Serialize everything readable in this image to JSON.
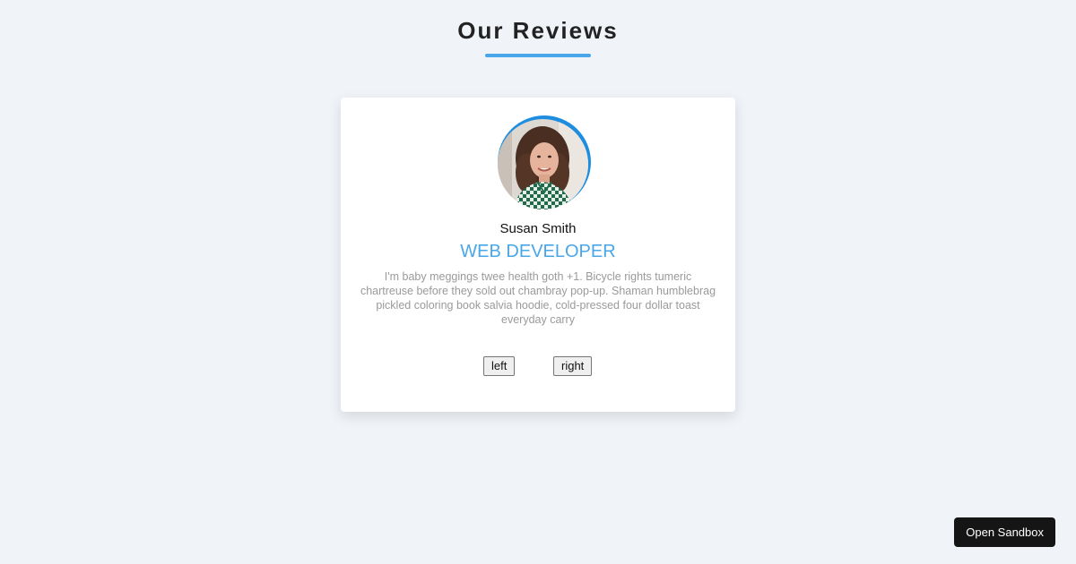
{
  "page": {
    "title": "Our Reviews"
  },
  "review": {
    "name": "Susan Smith",
    "job": "web developer",
    "text": "I'm baby meggings twee health goth +1. Bicycle rights tumeric chartreuse before they sold out chambray pop-up. Shaman humblebrag pickled coloring book salvia hoodie, cold-pressed four dollar toast everyday carry",
    "avatar": "person-photo"
  },
  "controls": {
    "left_label": "left",
    "right_label": "right"
  },
  "sandbox": {
    "label": "Open Sandbox"
  },
  "colors": {
    "accent": "#49a6e9",
    "ring": "#1e8de0",
    "background": "#f0f4f8"
  }
}
